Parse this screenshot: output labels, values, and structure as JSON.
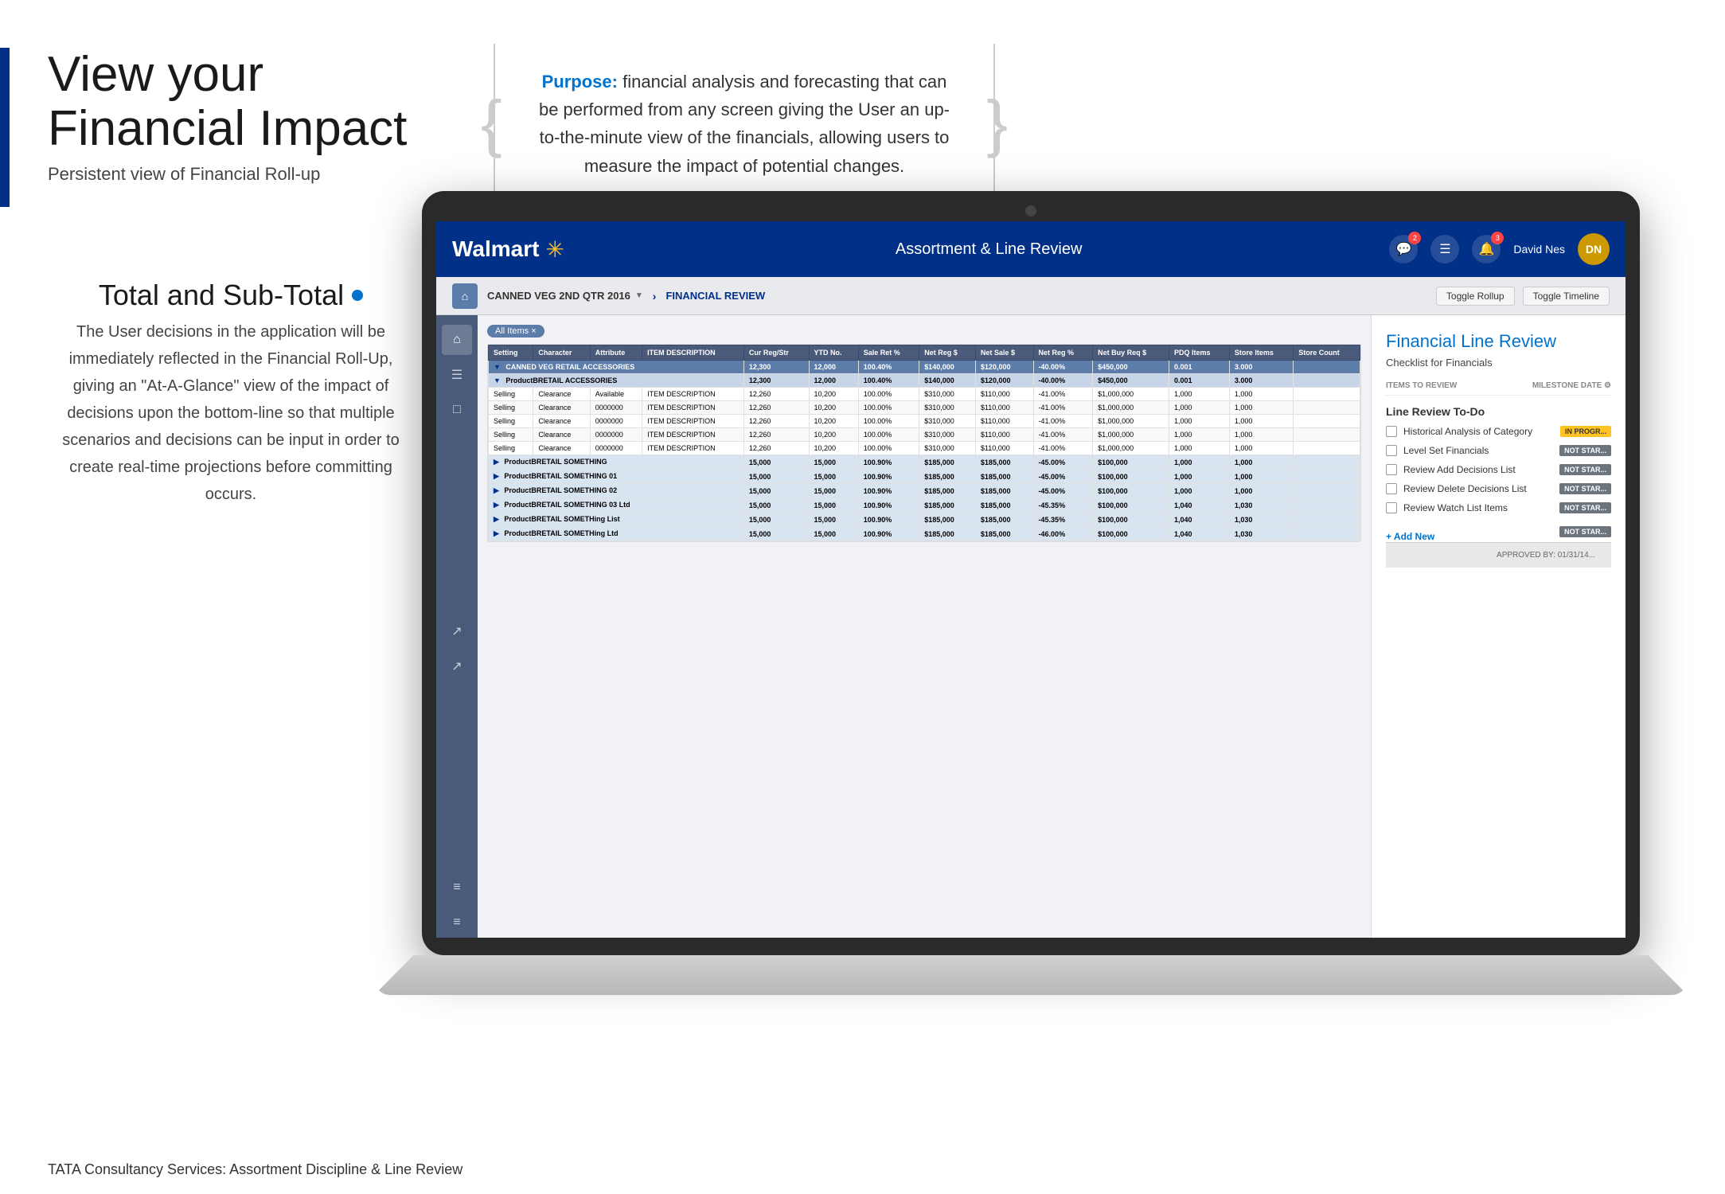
{
  "page": {
    "title": "View your Financial Impact",
    "subtitle": "Persistent view of Financial Roll-up",
    "purpose_label": "Purpose:",
    "purpose_text": "financial analysis and forecasting that can be performed from any screen giving the User an up-to-the-minute view of the financials, allowing users to measure the impact of potential changes.",
    "description_title": "Total and Sub-Total",
    "description_body": "The User decisions in the application will be immediately reflected in the Financial Roll-Up, giving an \"At-A-Glance\" view of the impact of decisions upon the bottom-line so that multiple scenarios and decisions can be input in order to create real-time projections before committing occurs.",
    "footer": "TATA Consultancy Services: Assortment Discipline & Line Review"
  },
  "app": {
    "brand": "Walmart",
    "brand_star": "✳",
    "header_title": "Assortment & Line Review",
    "user_name": "David Nes",
    "breadcrumb_home": "⌂",
    "breadcrumb_category": "CANNED VEG 2ND QTR 2016",
    "breadcrumb_separator": "›",
    "breadcrumb_current": "FINANCIAL REVIEW",
    "toggle_rollup": "Toggle Rollup",
    "toggle_timeline": "Toggle Timeline",
    "sidebar_icons": [
      "⌂",
      "≡",
      "□",
      "↗",
      "↗",
      "≡",
      "≡"
    ]
  },
  "header_icons": {
    "chat_badge": "2",
    "alert_badge": "3"
  },
  "table": {
    "columns": [
      "Setting",
      "Character",
      "Attribute",
      "ITEM DESCRIPTION",
      "Cur Reg/Str",
      "YTD No.",
      "Sale Ret %",
      "Net Reg $",
      "Net Sale $",
      "Net Reg %",
      "Net Buy Req $",
      "PDQ Items",
      "Store Items",
      "Store Count"
    ],
    "totals_row": [
      "CANNED VEG RETAIL ACCESSORIES",
      "",
      "",
      "",
      "12,300",
      "12,000",
      "100.40%",
      "$140,000",
      "$120,000",
      "-40.00%",
      "$450,000",
      "0.001",
      "3.000"
    ],
    "sub_group": "ProductBRETAIL ACCESSORIES",
    "rows": [
      [
        "Selling",
        "Clearance",
        "Available",
        "ITEM DESCRIPTION",
        "12,260",
        "10,200",
        "100.00%",
        "$310,000",
        "$110,000",
        "-41.00%",
        "$1,000,000",
        "1,000",
        "1,000"
      ],
      [
        "Selling",
        "Clearance",
        "0000000",
        "ITEM DESCRIPTION",
        "12,260",
        "10,200",
        "100.00%",
        "$310,000",
        "$110,000",
        "-41.00%",
        "$1,000,000",
        "1,000",
        "1,000"
      ],
      [
        "Selling",
        "Clearance",
        "0000000",
        "ITEM DESCRIPTION",
        "12,260",
        "10,200",
        "100.00%",
        "$310,000",
        "$110,000",
        "-41.00%",
        "$1,000,000",
        "1,000",
        "1,000"
      ],
      [
        "Selling",
        "Clearance",
        "0000000",
        "ITEM DESCRIPTION",
        "12,260",
        "10,200",
        "100.00%",
        "$310,000",
        "$110,000",
        "-41.00%",
        "$1,000,000",
        "1,000",
        "1,000"
      ],
      [
        "Selling",
        "Clearance",
        "0000000",
        "ITEM DESCRIPTION",
        "12,260",
        "10,200",
        "100.00%",
        "$310,000",
        "$110,000",
        "-41.00%",
        "$1,000,000",
        "1,000",
        "1,000"
      ]
    ],
    "group_rows": [
      {
        "label": "ProductBRETAIL SOMETHING",
        "vals": [
          "15,000",
          "15,000",
          "100.90%",
          "$185,000",
          "$185,000",
          "-45.00%",
          "$100,000",
          "1,000",
          "1,000"
        ]
      },
      {
        "label": "ProductBRETAIL SOMETHING 01",
        "vals": [
          "15,000",
          "15,000",
          "100.90%",
          "$185,000",
          "$185,000",
          "-45.00%",
          "$100,000",
          "1,000",
          "1,000"
        ]
      },
      {
        "label": "ProductBRETAIL SOMETHING 02",
        "vals": [
          "15,000",
          "15,000",
          "100.90%",
          "$185,000",
          "$185,000",
          "-45.00%",
          "$100,000",
          "1,000",
          "1,000"
        ]
      },
      {
        "label": "ProductBRETAIL SOMETHING 03 Ltd",
        "vals": [
          "15,000",
          "15,000",
          "100.90%",
          "$185,000",
          "$185,000",
          "-45.35%",
          "$100,000",
          "1,040",
          "1,030"
        ]
      },
      {
        "label": "ProductBRETAIL SOMETHing List",
        "vals": [
          "15,000",
          "15,000",
          "100.90%",
          "$185,000",
          "$185,000",
          "-45.35%",
          "$100,000",
          "1,040",
          "1,030"
        ]
      },
      {
        "label": "ProductBRETAIL SOMETHing Ltd",
        "vals": [
          "15,000",
          "15,000",
          "100.90%",
          "$185,000",
          "$185,000",
          "-46.00%",
          "$100,000",
          "1,040",
          "1,030"
        ]
      }
    ]
  },
  "right_panel": {
    "title": "Financial Line Review",
    "subtitle": "Checklist for Financials",
    "col1": "ITEMS TO REVIEW",
    "col2": "MILESTONE DATE",
    "section_title": "Line Review To-Do",
    "checklist": [
      {
        "label": "Historical Analysis of Category",
        "status": "IN PROGR...",
        "status_type": "in-progress"
      },
      {
        "label": "Level Set Financials",
        "status": "NOT STAR...",
        "status_type": "not-started"
      },
      {
        "label": "Review Add Decisions List",
        "status": "NOT STAR...",
        "status_type": "not-started"
      },
      {
        "label": "Review Delete Decisions List",
        "status": "NOT STAR...",
        "status_type": "not-started"
      },
      {
        "label": "Review Watch List Items",
        "status": "NOT STAR...",
        "status_type": "not-started"
      }
    ],
    "add_new": "+ Add New",
    "add_new_status": "NOT STAR..."
  }
}
